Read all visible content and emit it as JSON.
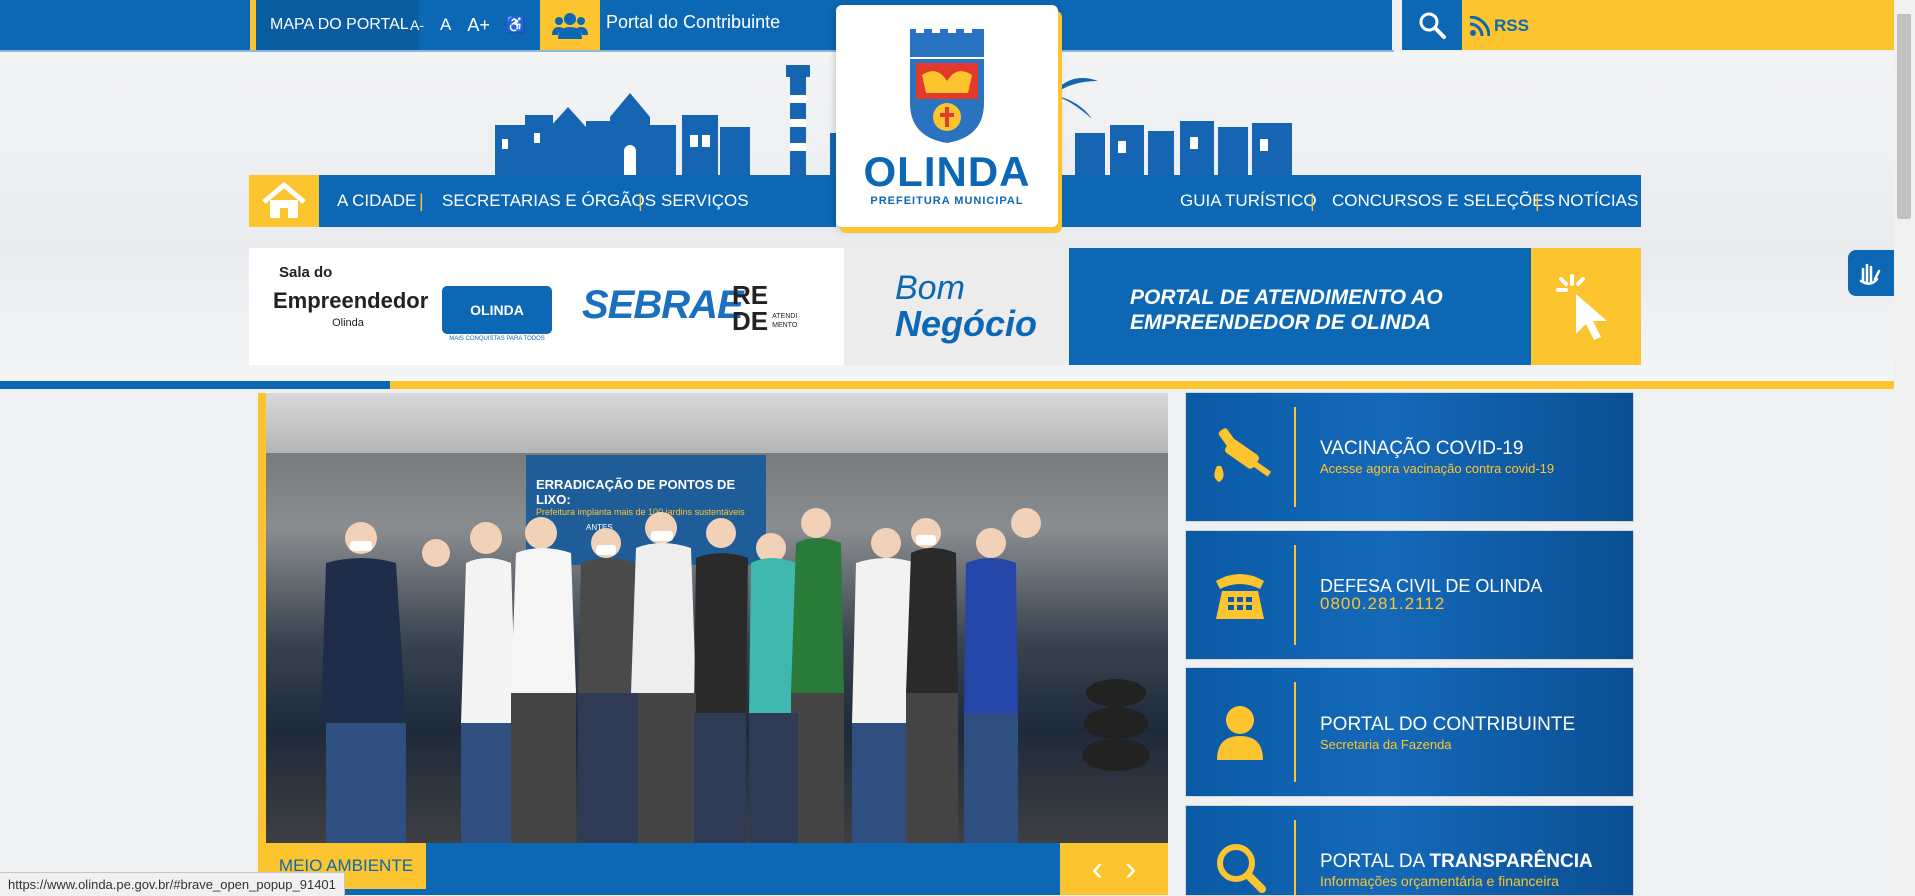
{
  "topbar": {
    "portal_map": "MAPA DO PORTAL",
    "font_small": "A-",
    "font_normal": "A",
    "font_large": "A+",
    "contribuinte": "Portal do Contribuinte",
    "rss": "RSS"
  },
  "logo": {
    "name": "OLINDA",
    "subtitle": "PREFEITURA MUNICIPAL"
  },
  "nav": {
    "left": [
      "A CIDADE",
      "SECRETARIAS E ÓRGÃOS",
      "SERVIÇOS"
    ],
    "right": [
      "GUIA TURÍSTICO",
      "CONCURSOS E SELEÇÕES",
      "NOTÍCIAS"
    ]
  },
  "banner": {
    "sala_line1": "Sala do",
    "sala_line2": "Empreendedor",
    "sala_line3": "Olinda",
    "olinda_badge": "OLINDA",
    "olinda_badge_sub": "MAIS CONQUISTAS PARA TODOS",
    "sebrae": "SEBRAE",
    "rede_1": "RE",
    "rede_2": "DE",
    "rede_small": "ATENDI MENTO",
    "bom_1": "Bom",
    "bom_2": "Negócio",
    "portal_line1": "PORTAL DE ATENDIMENTO AO",
    "portal_line2": "EMPREENDEDOR DE OLINDA"
  },
  "slider": {
    "photo_text_1": "ERRADICAÇÃO DE PONTOS DE LIXO:",
    "photo_text_2": "Prefeitura implanta mais de 100 jardins sustentáveis",
    "photo_text_3": "ANTES",
    "tag": "MEIO AMBIENTE",
    "prev": "‹",
    "next": "›"
  },
  "cards": [
    {
      "title": "VACINAÇÃO COVID-19",
      "subtitle": "Acesse agora vacinação contra covid-19",
      "icon": "syringe-icon"
    },
    {
      "title": "DEFESA CIVIL DE OLINDA",
      "subtitle": "0800.281.2112",
      "icon": "phone-icon"
    },
    {
      "title": "PORTAL DO CONTRIBUINTE",
      "subtitle": "Secretaria da Fazenda",
      "icon": "user-icon"
    },
    {
      "title_a": "PORTAL DA ",
      "title_b": "TRANSPARÊNCIA",
      "subtitle": "Informações orçamentária e financeira",
      "icon": "magnifier-icon"
    }
  ],
  "status_url": "https://www.olinda.pe.gov.br/#brave_open_popup_91401",
  "colors": {
    "blue": "#0c68b4",
    "yellow": "#fcc52f"
  }
}
